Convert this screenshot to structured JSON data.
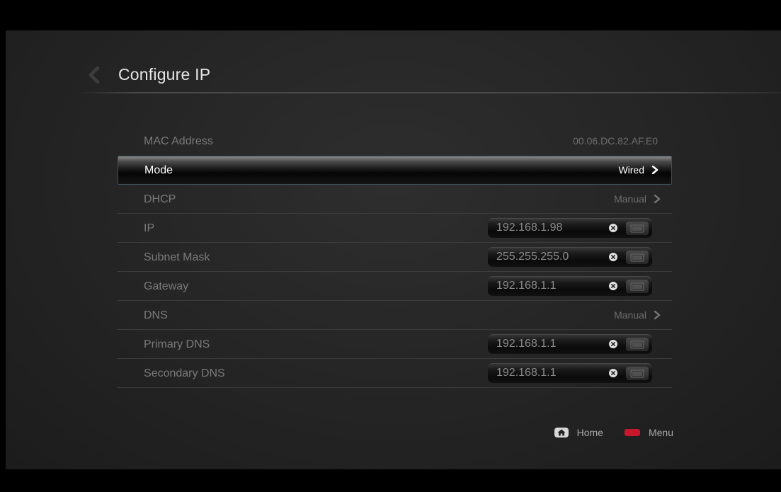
{
  "header": {
    "title": "Configure IP",
    "back_icon": "chevron-left-icon"
  },
  "settings": {
    "mac": {
      "label": "MAC Address",
      "value": "00.06.DC.82.AF.E0"
    },
    "mode": {
      "label": "Mode",
      "value": "Wired"
    },
    "dhcp": {
      "label": "DHCP",
      "value": "Manual"
    },
    "ip": {
      "label": "IP",
      "value": "192.168.1.98"
    },
    "subnet": {
      "label": "Subnet Mask",
      "value": "255.255.255.0"
    },
    "gateway": {
      "label": "Gateway",
      "value": "192.168.1.1"
    },
    "dns": {
      "label": "DNS",
      "value": "Manual"
    },
    "primary_dns": {
      "label": "Primary DNS",
      "value": "192.168.1.1"
    },
    "secondary_dns": {
      "label": "Secondary DNS",
      "value": "192.168.1.1"
    }
  },
  "footer": {
    "home_label": "Home",
    "menu_label": "Menu",
    "menu_color": "#c8162d"
  },
  "colors": {
    "background": "#262626",
    "selected_border": "#3f4f58"
  }
}
